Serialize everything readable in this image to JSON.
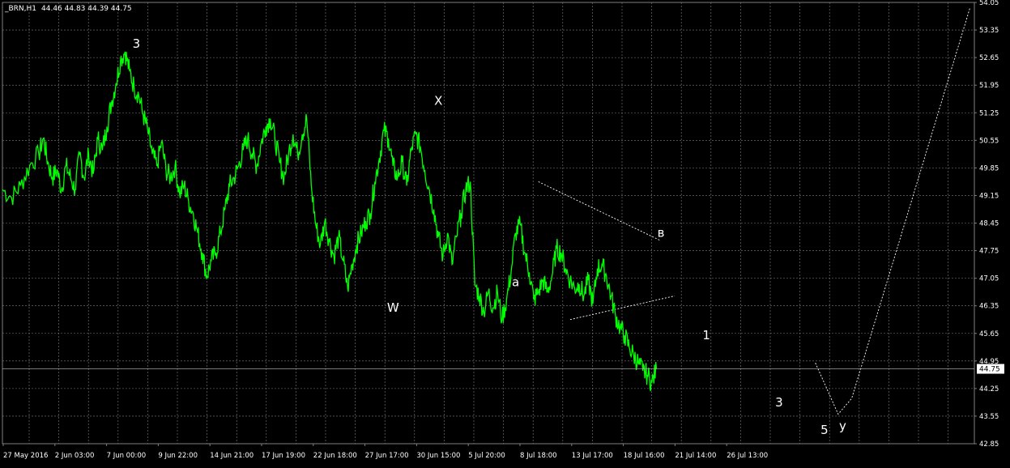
{
  "header": {
    "symbol": "_BRN,H1",
    "ohlc": "44.46 44.83 44.39 44.75"
  },
  "colors": {
    "background": "#000000",
    "price_line": "#00ff00",
    "grid": "#7f7f7f",
    "axis_text": "#ffffff",
    "annotation": "#ffffff",
    "current_price_bg": "#ffffff",
    "current_price_text": "#000000"
  },
  "current_price": {
    "label": "44.75",
    "value": 44.75
  },
  "chart_data": {
    "type": "line",
    "title": "",
    "xlabel": "",
    "ylabel": "",
    "ylim": [
      42.85,
      54.05
    ],
    "y_ticks": [
      "54.05",
      "53.35",
      "52.65",
      "51.95",
      "51.25",
      "50.55",
      "49.85",
      "49.15",
      "48.45",
      "47.75",
      "47.05",
      "46.35",
      "45.65",
      "44.95",
      "44.25",
      "43.55",
      "42.85"
    ],
    "x_ticks": [
      "27 May 2016",
      "2 Jun 03:00",
      "7 Jun 00:00",
      "9 Jun 22:00",
      "14 Jun 21:00",
      "17 Jun 19:00",
      "22 Jun 18:00",
      "27 Jun 17:00",
      "30 Jun 15:00",
      "5 Jul 20:00",
      "8 Jul 18:00",
      "13 Jul 17:00",
      "18 Jul 16:00",
      "21 Jul 14:00",
      "26 Jul 13:00"
    ],
    "grid": true,
    "series": [
      {
        "values": [
          [
            0,
            49.3
          ],
          [
            2,
            49.1
          ],
          [
            4,
            49.4
          ],
          [
            6,
            49.9
          ],
          [
            8,
            50.2
          ],
          [
            9,
            50.6
          ],
          [
            10,
            50.0
          ],
          [
            11,
            49.6
          ],
          [
            12,
            49.8
          ],
          [
            13,
            49.3
          ],
          [
            14,
            49.9
          ],
          [
            15,
            49.6
          ],
          [
            16,
            49.3
          ],
          [
            17,
            50.2
          ],
          [
            18,
            49.6
          ],
          [
            19,
            50.2
          ],
          [
            20,
            49.7
          ],
          [
            21,
            50.6
          ],
          [
            22,
            50.3
          ],
          [
            23,
            50.9
          ],
          [
            24,
            51.5
          ],
          [
            25,
            52.0
          ],
          [
            26,
            52.6
          ],
          [
            27,
            52.8
          ],
          [
            28,
            52.3
          ],
          [
            29,
            51.9
          ],
          [
            30,
            51.7
          ],
          [
            31,
            51.2
          ],
          [
            32,
            50.8
          ],
          [
            33,
            50.2
          ],
          [
            34,
            49.9
          ],
          [
            35,
            50.5
          ],
          [
            36,
            49.8
          ],
          [
            37,
            49.6
          ],
          [
            38,
            49.9
          ],
          [
            39,
            49.2
          ],
          [
            40,
            49.4
          ],
          [
            41,
            49.0
          ],
          [
            42,
            48.7
          ],
          [
            43,
            48.2
          ],
          [
            44,
            47.7
          ],
          [
            45,
            47.1
          ],
          [
            46,
            47.5
          ],
          [
            47,
            47.7
          ],
          [
            48,
            48.2
          ],
          [
            49,
            48.8
          ],
          [
            50,
            49.4
          ],
          [
            51,
            49.6
          ],
          [
            52,
            49.9
          ],
          [
            53,
            50.3
          ],
          [
            54,
            50.6
          ],
          [
            55,
            50.2
          ],
          [
            56,
            49.9
          ],
          [
            57,
            50.5
          ],
          [
            58,
            50.9
          ],
          [
            59,
            51.1
          ],
          [
            60,
            50.6
          ],
          [
            61,
            50.0
          ],
          [
            62,
            49.6
          ],
          [
            63,
            50.2
          ],
          [
            64,
            50.7
          ],
          [
            65,
            50.2
          ],
          [
            66,
            50.7
          ],
          [
            67,
            51.1
          ],
          [
            68,
            49.4
          ],
          [
            69,
            48.4
          ],
          [
            70,
            47.9
          ],
          [
            71,
            48.5
          ],
          [
            72,
            48.0
          ],
          [
            73,
            47.6
          ],
          [
            74,
            48.1
          ],
          [
            75,
            47.5
          ],
          [
            76,
            46.8
          ],
          [
            77,
            47.4
          ],
          [
            78,
            47.9
          ],
          [
            79,
            48.2
          ],
          [
            80,
            48.5
          ],
          [
            81,
            48.7
          ],
          [
            82,
            49.5
          ],
          [
            83,
            50.1
          ],
          [
            84,
            50.8
          ],
          [
            85,
            50.6
          ],
          [
            86,
            49.9
          ],
          [
            87,
            49.6
          ],
          [
            88,
            50.0
          ],
          [
            89,
            49.4
          ],
          [
            90,
            50.3
          ],
          [
            91,
            50.7
          ],
          [
            92,
            50.4
          ],
          [
            93,
            49.8
          ],
          [
            94,
            49.3
          ],
          [
            95,
            48.8
          ],
          [
            96,
            48.1
          ],
          [
            97,
            47.6
          ],
          [
            98,
            48.2
          ],
          [
            99,
            47.4
          ],
          [
            100,
            48.1
          ],
          [
            101,
            48.7
          ],
          [
            102,
            49.3
          ],
          [
            103,
            49.5
          ],
          [
            104,
            46.9
          ],
          [
            105,
            46.6
          ],
          [
            106,
            46.2
          ],
          [
            107,
            46.7
          ],
          [
            108,
            46.3
          ],
          [
            109,
            46.7
          ],
          [
            110,
            46.0
          ],
          [
            111,
            46.5
          ],
          [
            112,
            47.2
          ],
          [
            113,
            48.2
          ],
          [
            114,
            48.4
          ],
          [
            115,
            47.7
          ],
          [
            116,
            47.2
          ],
          [
            117,
            46.5
          ],
          [
            118,
            46.7
          ],
          [
            119,
            47.0
          ],
          [
            120,
            46.7
          ],
          [
            121,
            47.1
          ],
          [
            122,
            47.8
          ],
          [
            123,
            47.7
          ],
          [
            124,
            47.3
          ],
          [
            125,
            47.0
          ],
          [
            126,
            46.8
          ],
          [
            127,
            46.9
          ],
          [
            128,
            46.6
          ],
          [
            129,
            47.0
          ],
          [
            130,
            46.4
          ],
          [
            131,
            47.3
          ],
          [
            132,
            47.4
          ],
          [
            133,
            47.1
          ],
          [
            134,
            46.6
          ],
          [
            135,
            46.1
          ],
          [
            136,
            45.8
          ],
          [
            137,
            45.6
          ],
          [
            138,
            45.3
          ],
          [
            139,
            45.1
          ],
          [
            140,
            44.9
          ],
          [
            141,
            44.7
          ],
          [
            142,
            44.6
          ],
          [
            143,
            44.4
          ],
          [
            144,
            44.75
          ]
        ]
      }
    ],
    "annotations": [
      {
        "text": "3",
        "x": 29.5,
        "y": 52.9
      },
      {
        "text": "X",
        "x": 96.0,
        "y": 51.45
      },
      {
        "text": "W",
        "x": 86.0,
        "y": 46.2
      },
      {
        "text": "a",
        "x": 113.0,
        "y": 46.85
      },
      {
        "text": "в",
        "x": 145.0,
        "y": 48.1
      },
      {
        "text": "1",
        "x": 155.0,
        "y": 45.5
      },
      {
        "text": "3",
        "x": 171.0,
        "y": 43.8
      },
      {
        "text": "5",
        "x": 181.0,
        "y": 43.1
      },
      {
        "text": "y",
        "x": 185.0,
        "y": 43.2
      }
    ],
    "dotted_lines": [
      {
        "points": [
          [
            118.0,
            49.5
          ],
          [
            145.0,
            48.0
          ]
        ]
      },
      {
        "points": [
          [
            125.0,
            46.0
          ],
          [
            148.0,
            46.6
          ]
        ]
      },
      {
        "points": [
          [
            179.0,
            44.9
          ],
          [
            184.0,
            43.6
          ],
          [
            187.0,
            44.0
          ],
          [
            213.0,
            53.9
          ]
        ]
      }
    ]
  }
}
